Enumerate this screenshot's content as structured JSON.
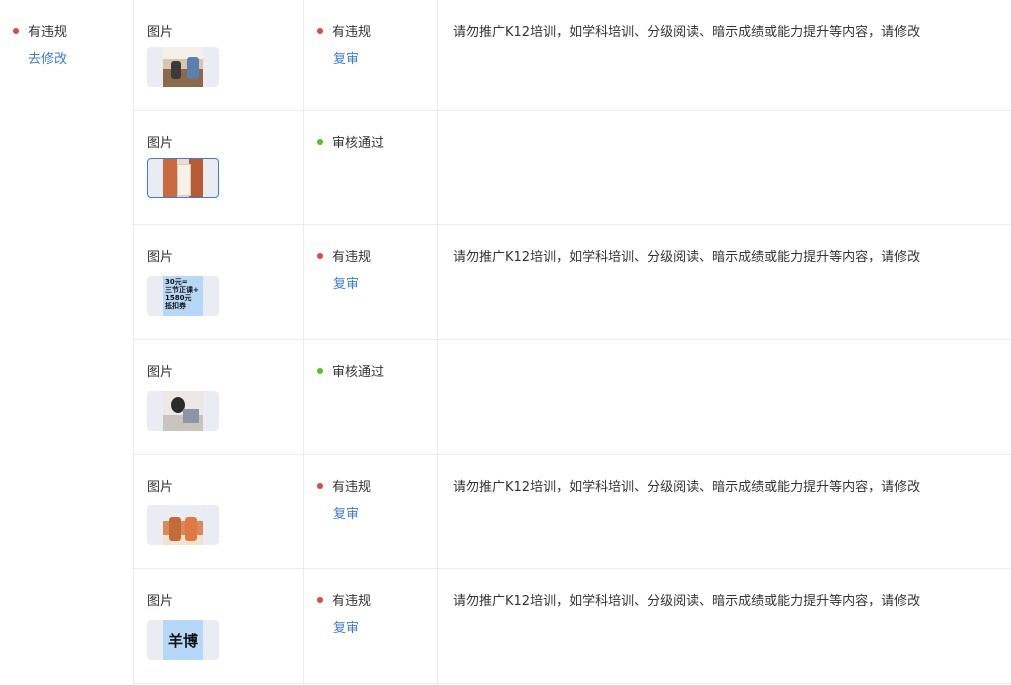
{
  "colors": {
    "violation_dot": "#e0483b",
    "pass_dot": "#52c41a",
    "link": "#3d7bd6"
  },
  "left": {
    "status": "有违规",
    "action": "去修改"
  },
  "rows": [
    {
      "type": "图片",
      "thumb_icon": "classroom-photo",
      "status": "有违规",
      "status_kind": "violation",
      "action": "复审",
      "reason": "请勿推广K12培训，如学科培训、分级阅读、暗示成绩或能力提升等内容，请修改"
    },
    {
      "type": "图片",
      "thumb_icon": "hallway-photo",
      "status": "审核通过",
      "status_kind": "pass",
      "action": "",
      "reason": ""
    },
    {
      "type": "图片",
      "thumb_icon": "promo-poster",
      "thumb_text": "30元=\n三节正课+\n1580元\n抵扣券",
      "status": "有违规",
      "status_kind": "violation",
      "action": "复审",
      "reason": "请勿推广K12培训，如学科培训、分级阅读、暗示成绩或能力提升等内容，请修改"
    },
    {
      "type": "图片",
      "thumb_icon": "study-photo",
      "status": "审核通过",
      "status_kind": "pass",
      "action": "",
      "reason": ""
    },
    {
      "type": "图片",
      "thumb_icon": "kids-photo",
      "status": "有违规",
      "status_kind": "violation",
      "action": "复审",
      "reason": "请勿推广K12培训，如学科培训、分级阅读、暗示成绩或能力提升等内容，请修改"
    },
    {
      "type": "图片",
      "thumb_icon": "text-image",
      "thumb_text": "羊博",
      "status": "有违规",
      "status_kind": "violation",
      "action": "复审",
      "reason": "请勿推广K12培训，如学科培训、分级阅读、暗示成绩或能力提升等内容，请修改"
    }
  ]
}
